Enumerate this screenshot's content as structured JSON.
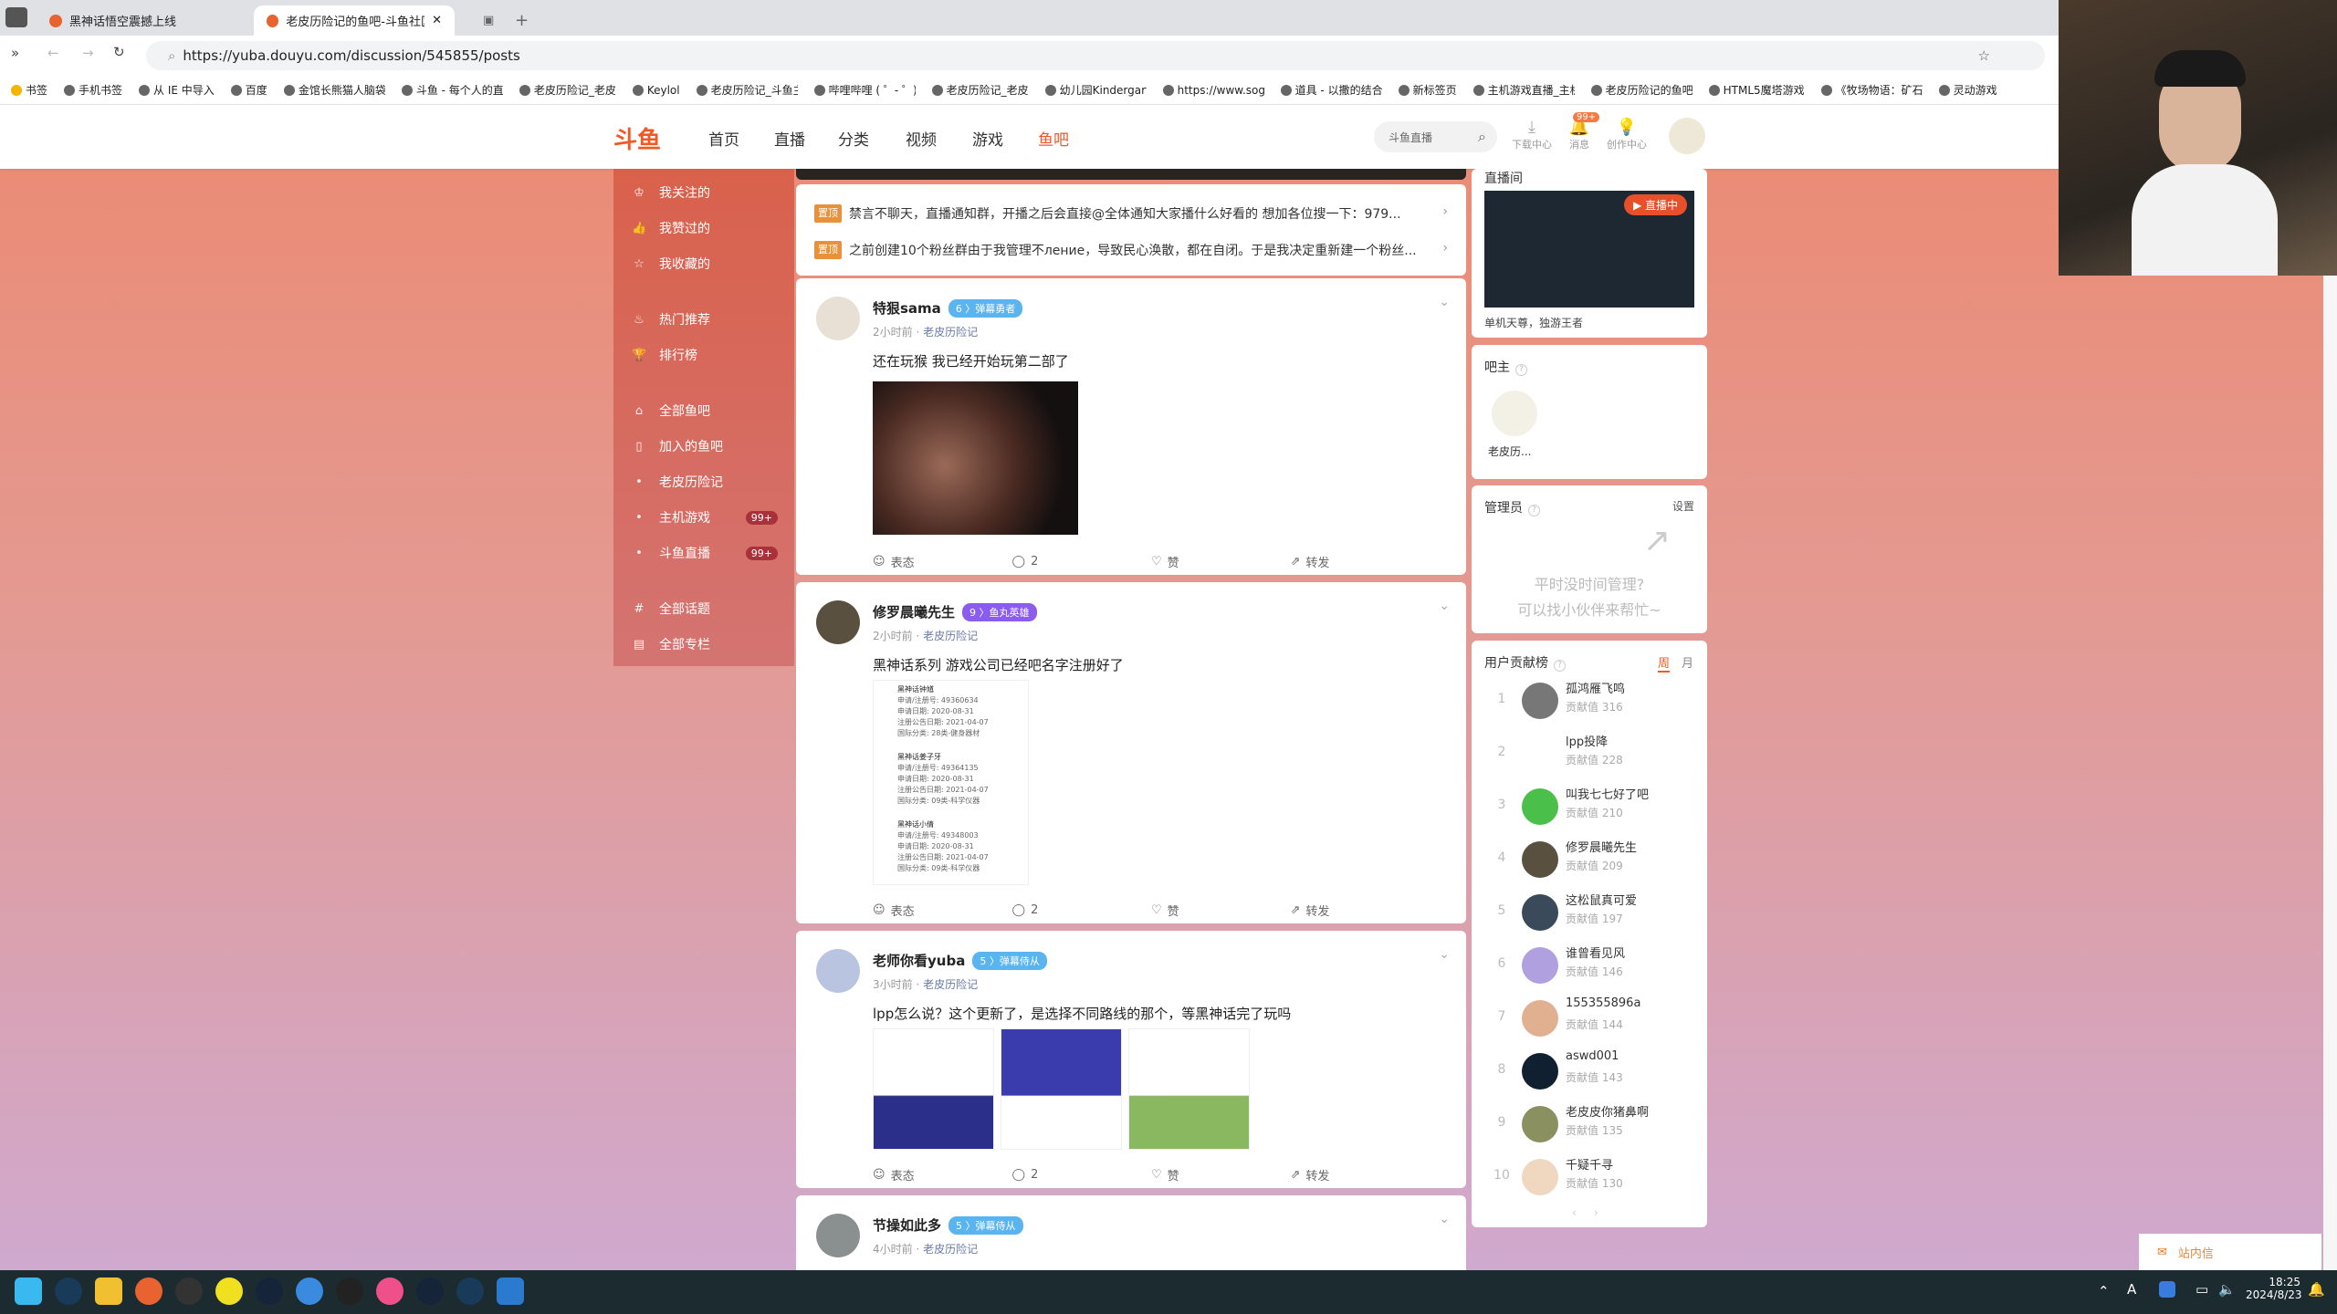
{
  "browser": {
    "tabs": [
      {
        "label": "黑神话悟空震撼上线"
      },
      {
        "label": "老皮历险记的鱼吧-斗鱼社区,直"
      }
    ],
    "url": "https://yuba.douyu.com/discussion/545855/posts",
    "bookmarks": [
      "书签",
      "手机书签",
      "从 IE 中导入",
      "百度",
      "金馆长熊猫人脑袋",
      "斗鱼 - 每个人的直",
      "老皮历险记_老皮",
      "Keylol",
      "老皮历险记_斗鱼主",
      "哔哩哔哩 ( ゜- ゜)つ",
      "老皮历险记_老皮",
      "幼儿园Kindergarten",
      "https://www.sog",
      "道具 - 以撒的结合",
      "新标签页",
      "主机游戏直播_主机",
      "老皮历险记的鱼吧",
      "HTML5魔塔游戏",
      "《牧场物语：矿石",
      "灵动游戏"
    ]
  },
  "header": {
    "logo": "斗鱼 DOUYU.COM",
    "nav": [
      "首页",
      "直播",
      "分类",
      "视频",
      "游戏",
      "鱼吧"
    ],
    "search_placeholder": "斗鱼直播",
    "icons": [
      {
        "label": "下载中心",
        "icon": "download-icon"
      },
      {
        "label": "消息",
        "icon": "bell-icon",
        "badge": "99+"
      },
      {
        "label": "创作中心",
        "icon": "bulb-icon"
      }
    ],
    "accent": "#f15a24"
  },
  "sidebar": {
    "items": [
      {
        "label": "我关注的",
        "icon": "crown"
      },
      {
        "label": "我赞过的",
        "icon": "thumb"
      },
      {
        "label": "我收藏的",
        "icon": "star"
      },
      {
        "label": "热门推荐",
        "icon": "fire"
      },
      {
        "label": "排行榜",
        "icon": "trophy"
      },
      {
        "label": "全部鱼吧",
        "icon": "house"
      },
      {
        "label": "加入的鱼吧",
        "icon": "bookmark"
      },
      {
        "label": "老皮历险记",
        "icon": "dot"
      },
      {
        "label": "主机游戏",
        "icon": "dot",
        "badge": "99+"
      },
      {
        "label": "斗鱼直播",
        "icon": "dot",
        "badge": "99+"
      },
      {
        "label": "全部话题",
        "icon": "hash"
      },
      {
        "label": "全部专栏",
        "icon": "book"
      }
    ]
  },
  "pinned": [
    {
      "tag": "置顶",
      "text": "禁言不聊天，直播通知群，开播之后会直接@全体通知大家播什么好看的 想加各位搜一下：979..."
    },
    {
      "tag": "置顶",
      "text": "之前创建10个粉丝群由于我管理不ление，导致民心涣散，都在自闭。于是我决定重新建一个粉丝..."
    }
  ],
  "posts": [
    {
      "name": "特狠sama",
      "level": "6",
      "badge": "弹幕勇者",
      "time": "2小时前",
      "community": "老皮历险记",
      "text": "还在玩猴 我已经开始玩第二部了",
      "comments": "2"
    },
    {
      "name": "修罗晨曦先生",
      "level": "9",
      "badge": "鱼丸英雄",
      "time": "2小时前",
      "community": "老皮历险记",
      "text": "黑神话系列 游戏公司已经吧名字注册好了",
      "comments": "2",
      "image_rows": [
        [
          "黑神话钟馗",
          "申请/注册号: 49360634",
          "申请日期: 2020-08-31",
          "注册公告日期: 2021-04-07",
          "国际分类: 28类-健身器材"
        ],
        [
          "黑神话姜子牙",
          "申请/注册号: 49364135",
          "申请日期: 2020-08-31",
          "注册公告日期: 2021-04-07",
          "国际分类: 09类-科学仪器"
        ],
        [
          "黑神话小倩",
          "申请/注册号: 49348003",
          "申请日期: 2020-08-31",
          "注册公告日期: 2021-04-07",
          "国际分类: 09类-科学仪器"
        ]
      ]
    },
    {
      "name": "老师你看yuba",
      "level": "5",
      "badge": "弹幕侍从",
      "time": "3小时前",
      "community": "老皮历险记",
      "text": "lpp怎么说？这个更新了，是选择不同路线的那个，等黑神话完了玩吗",
      "comments": "2"
    },
    {
      "name": "节操如此多",
      "level": "5",
      "badge": "弹幕侍从",
      "time": "4小时前",
      "community": "老皮历险记"
    }
  ],
  "actions": {
    "react": "表态",
    "like": "赞",
    "share": "转发"
  },
  "right": {
    "live": {
      "title": "直播间",
      "badge": "直播中",
      "caption": "单机天尊，独游王者"
    },
    "owner": {
      "title": "吧主",
      "name": "老皮历..."
    },
    "admins": {
      "title": "管理员",
      "settings": "设置",
      "empty_line1": "平时没时间管理?",
      "empty_line2": "可以找小伙伴来帮忙~"
    },
    "ranking": {
      "title": "用户贡献榜",
      "tabs": [
        "周",
        "月"
      ],
      "active_tab": "周",
      "score_label": "贡献值",
      "users": [
        {
          "rank": "1",
          "name": "孤鸿雁飞鸣",
          "score": "316"
        },
        {
          "rank": "2",
          "name": "lpp投降",
          "score": "228"
        },
        {
          "rank": "3",
          "name": "叫我七七好了吧",
          "score": "210"
        },
        {
          "rank": "4",
          "name": "修罗晨曦先生",
          "score": "209"
        },
        {
          "rank": "5",
          "name": "这松鼠真可爱",
          "score": "197"
        },
        {
          "rank": "6",
          "name": "谁曾看见风",
          "score": "146"
        },
        {
          "rank": "7",
          "name": "155355896a",
          "score": "144"
        },
        {
          "rank": "8",
          "name": "aswd001",
          "score": "143"
        },
        {
          "rank": "9",
          "name": "老皮皮你猪鼻啊",
          "score": "135"
        },
        {
          "rank": "10",
          "name": "千疑千寻",
          "score": "130"
        }
      ]
    }
  },
  "mail_popup": "站内信",
  "taskbar": {
    "time": "18:25",
    "date": "2024/8/23",
    "ime": "A"
  }
}
